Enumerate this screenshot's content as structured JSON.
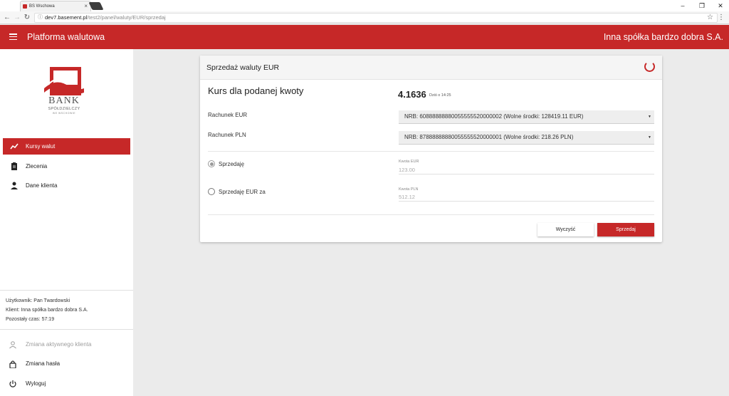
{
  "browser": {
    "tab_title": "BS Wschowa",
    "tab_close": "×",
    "url_host": "dev7.basement.pl",
    "url_path": "/test2/panel/waluty/EUR/sprzedaj",
    "window_minimize": "–",
    "window_maximize": "❐",
    "window_close": "✕"
  },
  "header": {
    "app_title": "Platforma walutowa",
    "company_name": "Inna spółka bardzo dobra S.A."
  },
  "logo": {
    "name": "BANK",
    "line1": "SPÓŁDZIELCZY",
    "line2": "WE WSCHOWIE"
  },
  "sidebar": {
    "items": [
      {
        "label": "Kursy walut",
        "icon": "trending-up-icon"
      },
      {
        "label": "Zlecenia",
        "icon": "clipboard-icon"
      },
      {
        "label": "Dane klienta",
        "icon": "person-icon"
      }
    ],
    "user_line": "Użytkownik: Pan Twardowski",
    "client_line": "Klient: Inna spółka bardzo dobra S.A.",
    "time_line": "Pozostały czas: 57:19",
    "bottom": [
      {
        "label": "Zmiana aktywnego klienta",
        "icon": "person-outline-icon"
      },
      {
        "label": "Zmiana hasła",
        "icon": "lock-icon"
      },
      {
        "label": "Wyloguj",
        "icon": "power-icon"
      }
    ]
  },
  "card": {
    "title": "Sprzedaż waluty EUR",
    "rate_label": "Kurs dla podanej kwoty",
    "rate_value": "4.1636",
    "rate_time": "Dziś o 14:25",
    "account_eur_label": "Rachunek EUR",
    "account_eur_value": "NRB: 60888888880055555520000002 (Wolne środki: 128419.11 EUR)",
    "account_pln_label": "Rachunek PLN",
    "account_pln_value": "NRB: 87888888880055555520000001 (Wolne środki: 218.26 PLN)",
    "option_sell": "Sprzedaję",
    "option_sell_for": "Sprzedaję EUR za",
    "amount_eur_label": "Kwota EUR",
    "amount_eur_value": "123.00",
    "amount_pln_label": "Kwota PLN",
    "amount_pln_value": "512.12",
    "clear_button": "Wyczyść",
    "sell_button": "Sprzedaj"
  },
  "colors": {
    "accent": "#c62828",
    "background": "#ebebeb"
  }
}
